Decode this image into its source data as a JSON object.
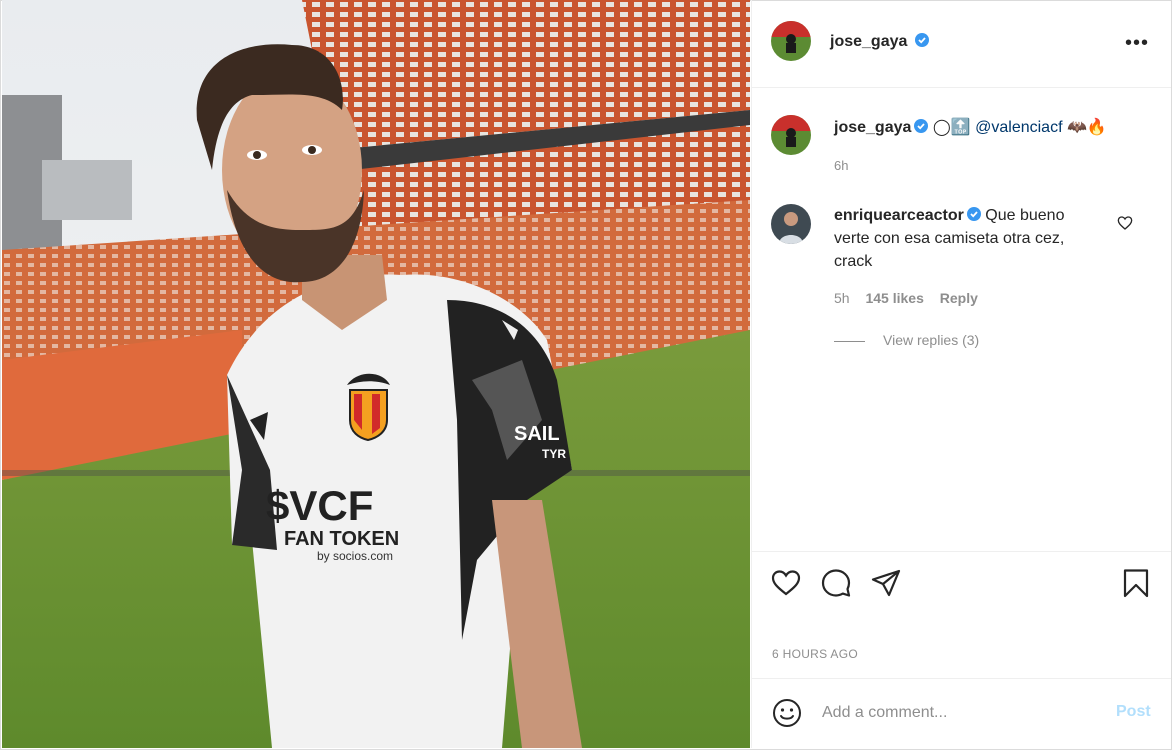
{
  "post": {
    "author": "jose_gaya",
    "author_verified": true,
    "more_icon": "more-horizontal-icon",
    "photo_alt": "Player in white Valencia CF home shirt in Mestalla stadium",
    "shirt_texts": {
      "sponsor_top": "$VCF",
      "sponsor_mid": "FAN TOKEN",
      "sponsor_bottom": "by socios.com",
      "sleeve": "SAIL",
      "sleeve_sub": "TYR"
    }
  },
  "caption": {
    "user": "jose_gaya",
    "prefix": "◯🔝",
    "mention": "@valenciacf",
    "suffix": "🦇🔥",
    "time": "6h"
  },
  "comments": [
    {
      "user": "enriquearceactor",
      "verified": true,
      "text": "Que bueno verte con esa camiseta otra cez, crack",
      "time": "5h",
      "likes": "145 likes",
      "reply": "Reply",
      "view_replies": "View replies (3)"
    }
  ],
  "actions": {
    "like_icon": "heart-icon",
    "comment_icon": "comment-icon",
    "share_icon": "paper-plane-icon",
    "save_icon": "bookmark-icon"
  },
  "timestamp": "6 HOURS AGO",
  "add_comment": {
    "placeholder": "Add a comment...",
    "post_label": "Post"
  },
  "colors": {
    "verified": "#3897f0",
    "mention": "#00376b",
    "muted": "#8e8e8e",
    "post_disabled": "#b2dffc"
  }
}
